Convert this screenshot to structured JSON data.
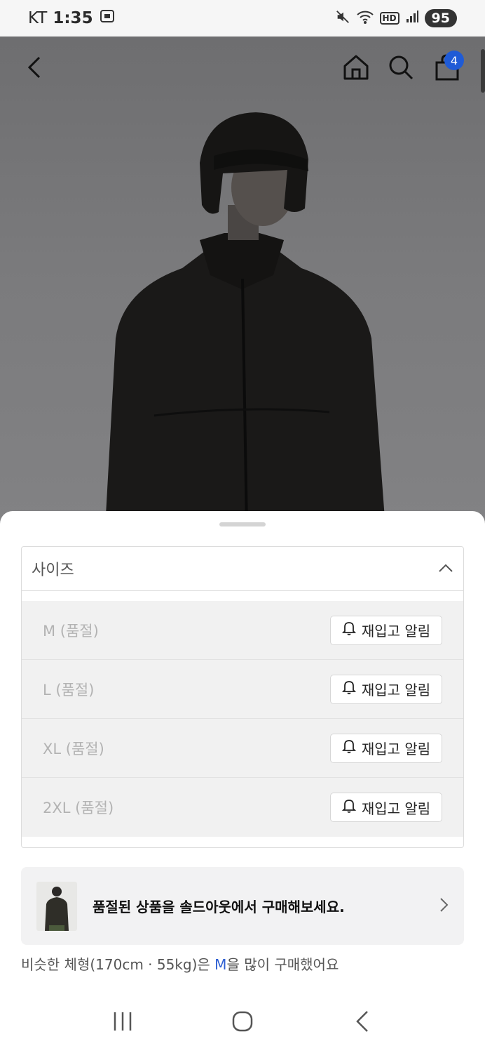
{
  "status_bar": {
    "carrier": "KT",
    "time": "1:35",
    "hd_label": "HD",
    "battery": "95"
  },
  "header": {
    "cart_count": "4"
  },
  "sheet": {
    "size_title": "사이즈",
    "sizes": [
      {
        "label": "M (품절)",
        "button": "재입고 알림"
      },
      {
        "label": "L (품절)",
        "button": "재입고 알림"
      },
      {
        "label": "XL (품절)",
        "button": "재입고 알림"
      },
      {
        "label": "2XL (품절)",
        "button": "재입고 알림"
      }
    ],
    "soldout_banner_text": "품절된 상품을 솔드아웃에서 구매해보세요.",
    "similar_prefix": "비슷한 체형(170cm · 55kg)은 ",
    "similar_highlight": "M",
    "similar_suffix": "을 많이 구매했어요"
  },
  "colors": {
    "accent": "#2d5fd3",
    "badge": "#1f5bd6"
  },
  "icons": [
    "back-icon",
    "home-icon",
    "search-icon",
    "bag-icon",
    "chevron-up-icon",
    "bell-icon",
    "chevron-right-icon",
    "recents-icon",
    "home-nav-icon",
    "back-nav-icon"
  ]
}
